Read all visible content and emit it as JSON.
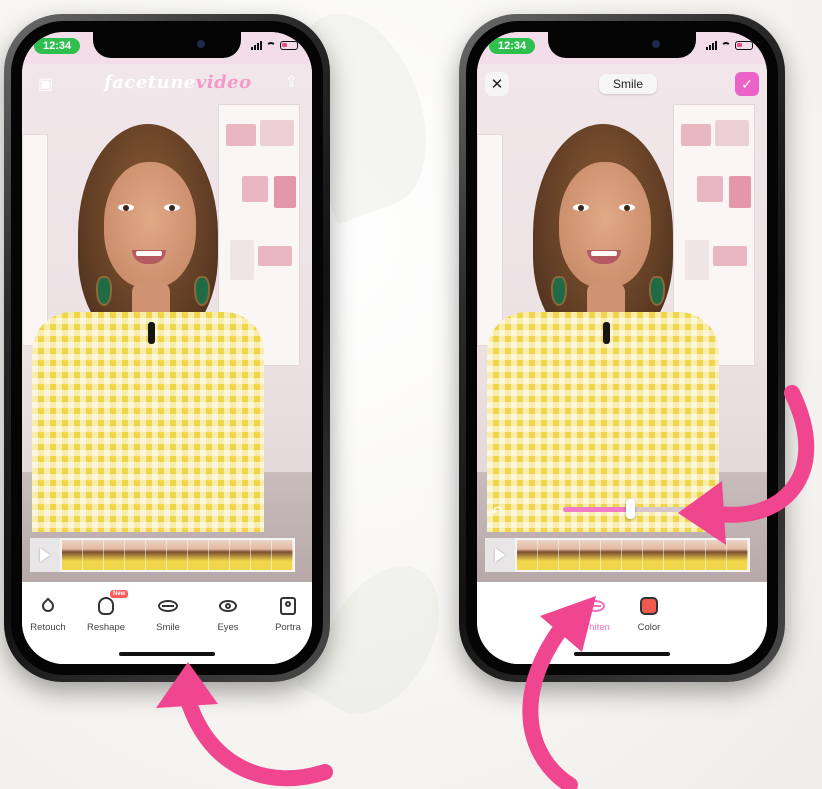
{
  "colors": {
    "accent_pink": "#ec63c7",
    "arrow_pink": "#f0468f",
    "time_green": "#2fbf4e"
  },
  "left_phone": {
    "status": {
      "time": "12:34"
    },
    "logo": {
      "main": "facetune",
      "video": "video"
    },
    "icons": {
      "gallery": "gallery-icon",
      "share": "share-icon"
    },
    "toolbar": [
      {
        "label": "Retouch",
        "icon": "drop-icon"
      },
      {
        "label": "Reshape",
        "icon": "reshape-icon",
        "badge": "New"
      },
      {
        "label": "Smile",
        "icon": "lips-icon"
      },
      {
        "label": "Eyes",
        "icon": "eye-icon"
      },
      {
        "label": "Portra",
        "icon": "portrait-icon"
      }
    ]
  },
  "right_phone": {
    "status": {
      "time": "12:34"
    },
    "title": "Smile",
    "slider": {
      "value": 0.5
    },
    "toolbar": [
      {
        "label": "Whiten",
        "icon": "lips-icon",
        "active": true
      },
      {
        "label": "Color",
        "icon": "color-swatch-icon",
        "active": false
      }
    ]
  }
}
